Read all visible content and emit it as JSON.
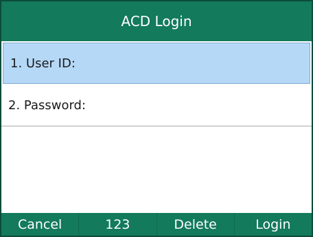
{
  "title": "ACD Login",
  "fields": [
    {
      "label": "1. User ID:",
      "value": "",
      "selected": true
    },
    {
      "label": "2. Password:",
      "value": "",
      "selected": false
    }
  ],
  "softkeys": [
    "Cancel",
    "123",
    "Delete",
    "Login"
  ],
  "colors": {
    "bar": "#137a5c",
    "selected": "#b5d8f7"
  }
}
